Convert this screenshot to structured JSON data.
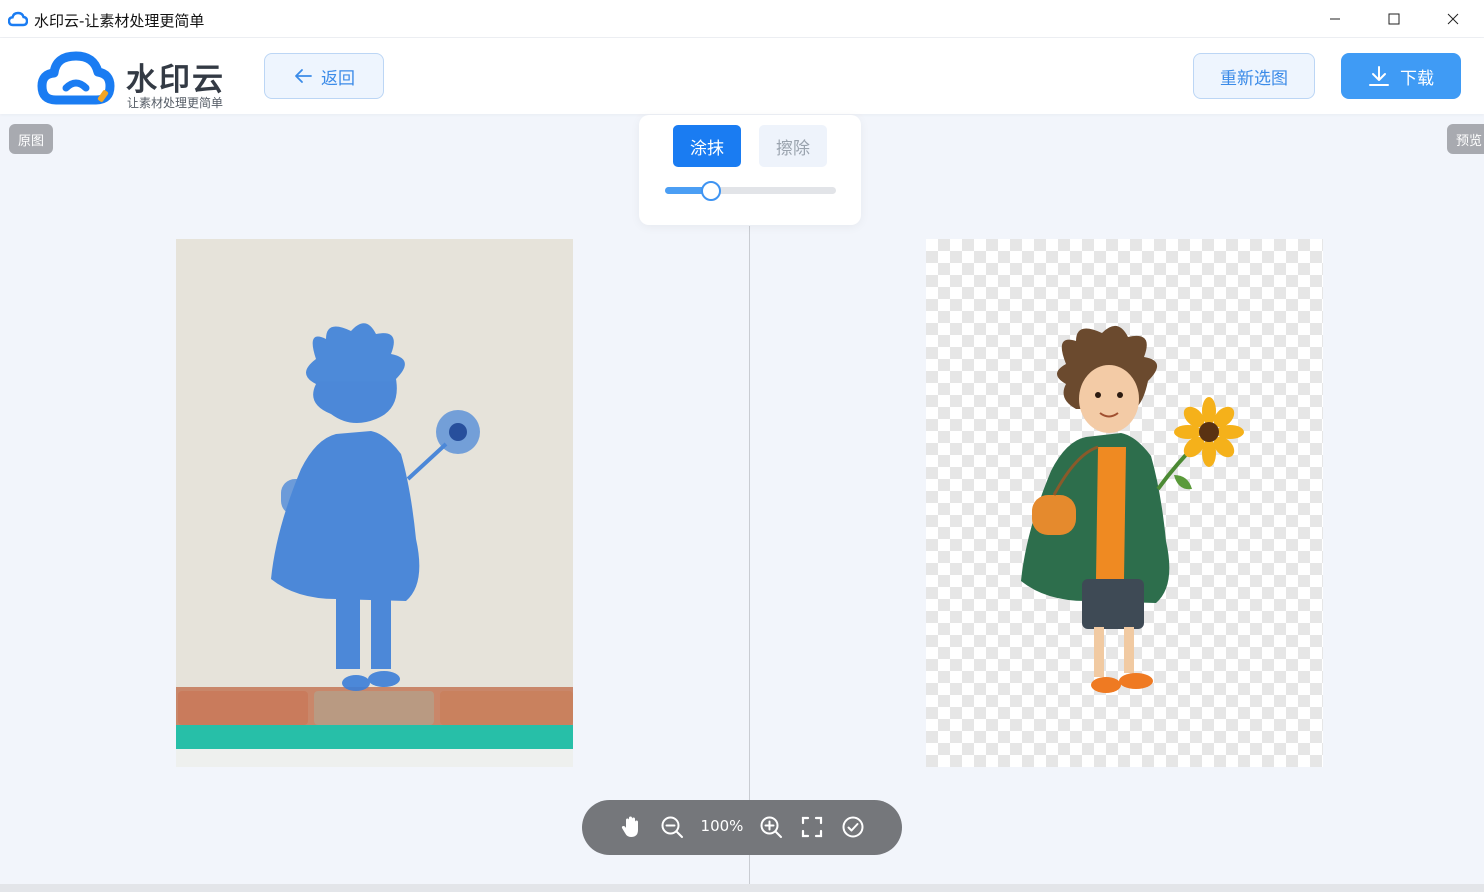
{
  "window": {
    "title": "水印云-让素材处理更简单"
  },
  "header": {
    "logo_title": "水印云",
    "logo_subtitle": "让素材处理更简单",
    "back_label": "返回",
    "reselect_label": "重新选图",
    "download_label": "下载"
  },
  "workspace": {
    "original_badge": "原图",
    "preview_badge": "预览"
  },
  "tools": {
    "smear_label": "涂抹",
    "erase_label": "擦除",
    "active_tool": "涂抹",
    "brush_size_fraction": 0.27
  },
  "zoombar": {
    "zoom_level": "100%",
    "icons": [
      "hand-icon",
      "zoom-out-icon",
      "zoom-in-icon",
      "fullscreen-icon",
      "check-circle-icon"
    ]
  },
  "colors": {
    "accent": "#1a7cf2",
    "download_bg": "#3f9bf5",
    "light_button_bg": "#eef5fe",
    "zoombar_bg": "#75777b"
  }
}
